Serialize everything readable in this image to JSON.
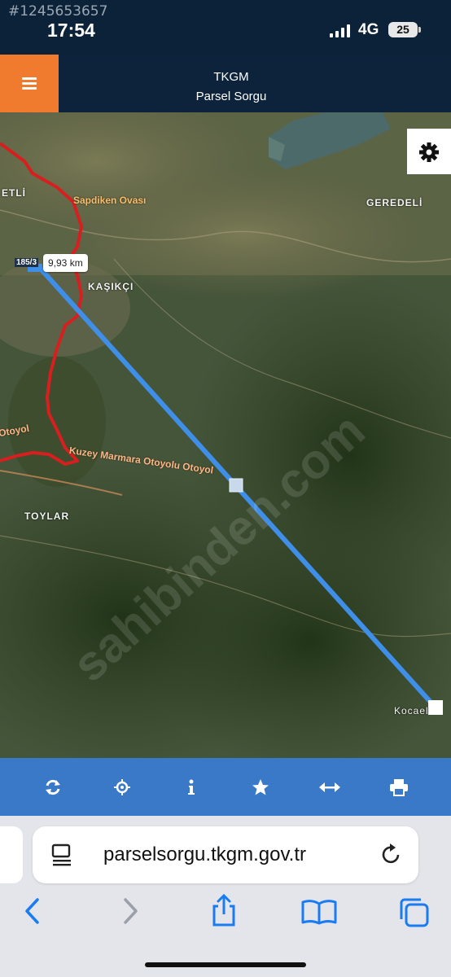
{
  "status_bar": {
    "overlay_id": "#1245653657",
    "time": "17:54",
    "network": "4G",
    "battery": "25"
  },
  "header": {
    "title": "TKGM",
    "subtitle": "Parsel Sorgu"
  },
  "map": {
    "places": [
      "ETLİ",
      "Sapdiken Ovası",
      "GEREDELİ",
      "KAŞIKÇI",
      "Otoyol",
      "Kuzey Marmara Otoyolu Otoyol",
      "TOYLAR",
      "Kocael"
    ],
    "measure_label": "9,93 km",
    "parcel_label": "185/3",
    "watermark": "sahibinden.com"
  },
  "toolbar": {
    "icons": [
      "refresh-icon",
      "locate-icon",
      "info-icon",
      "star-icon",
      "measure-icon",
      "print-icon"
    ]
  },
  "browser": {
    "url": "parselsorgu.tkgm.gov.tr"
  }
}
